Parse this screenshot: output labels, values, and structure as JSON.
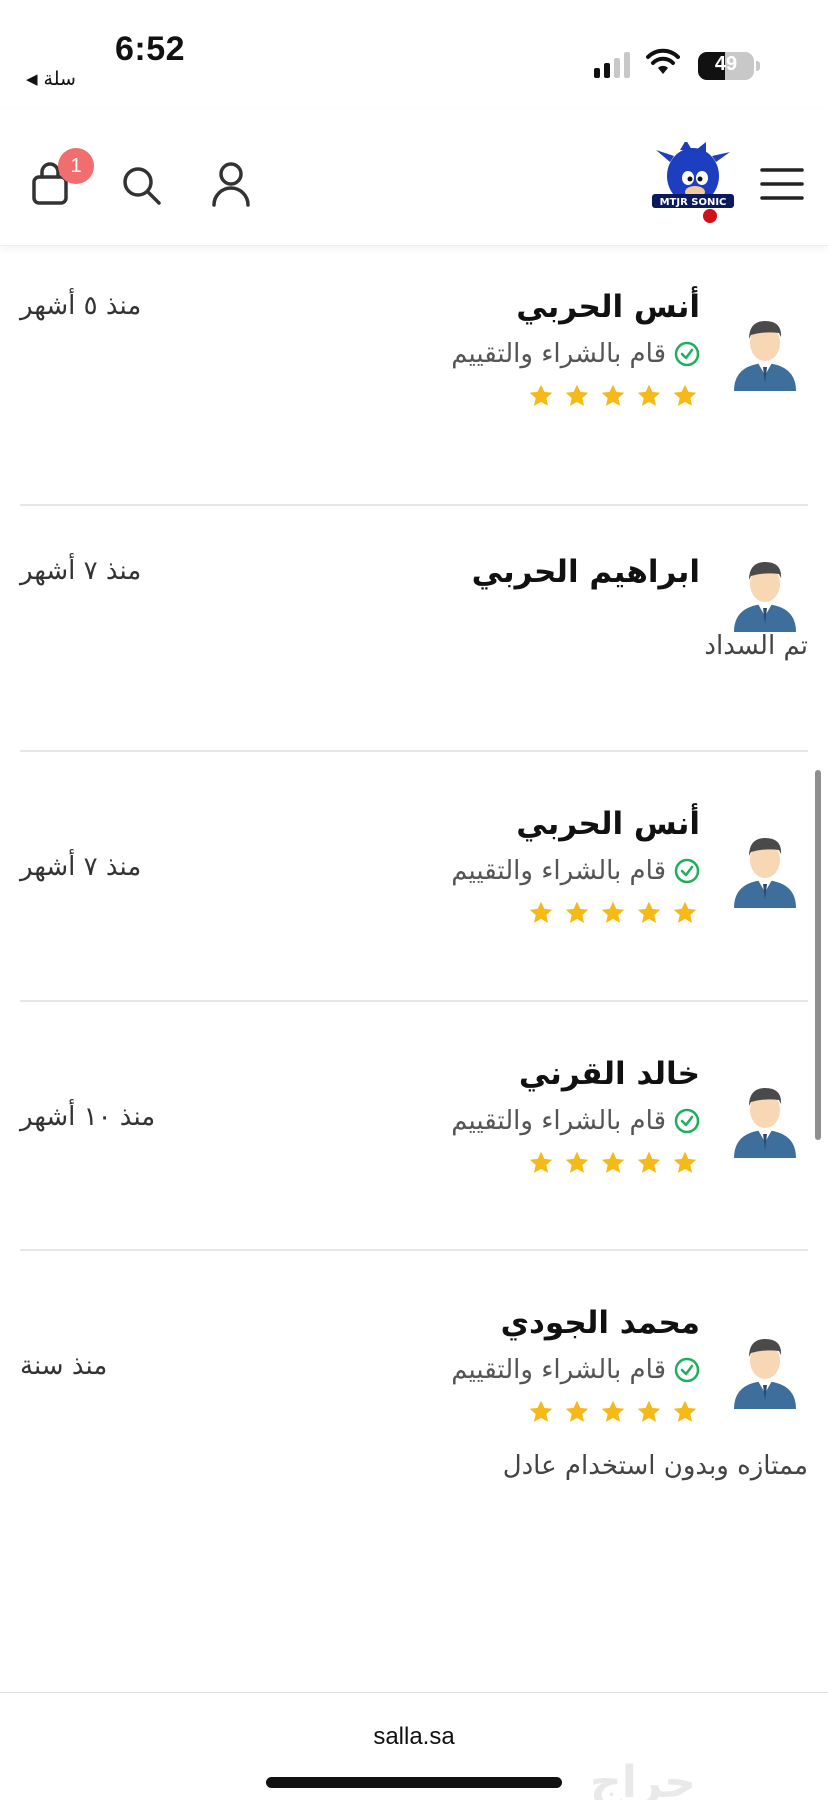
{
  "status_bar": {
    "time": "6:52",
    "back_app": "سلة",
    "back_icon": "back-triangle-icon",
    "battery_percent": "49",
    "battery_level": 0.49,
    "signal_bars": 2
  },
  "header": {
    "cart_badge": "1",
    "logo_text": "MTJR SONIC",
    "icons": [
      "cart-icon",
      "search-icon",
      "user-icon",
      "menu-icon"
    ]
  },
  "colors": {
    "star": "#f5b918",
    "verified": "#1fae5b",
    "badge": "#f26d6d"
  },
  "reviews": [
    {
      "name": "أنس الحربي",
      "verified_label": "قام بالشراء والتقييم",
      "rating": 5,
      "date": "منذ ٥ أشهر",
      "text": ""
    },
    {
      "name": "ابراهيم الحربي",
      "verified_label": "",
      "rating": 0,
      "date": "منذ ٧ أشهر",
      "text": "تم السداد"
    },
    {
      "name": "أنس الحربي",
      "verified_label": "قام بالشراء والتقييم",
      "rating": 5,
      "date": "منذ ٧ أشهر",
      "text": ""
    },
    {
      "name": "خالد القرني",
      "verified_label": "قام بالشراء والتقييم",
      "rating": 5,
      "date": "منذ ١٠ أشهر",
      "text": ""
    },
    {
      "name": "محمد الجودي",
      "verified_label": "قام بالشراء والتقييم",
      "rating": 5,
      "date": "منذ سنة",
      "text": "ممتازه وبدون استخدام عادل"
    }
  ],
  "browser": {
    "url": "salla.sa",
    "watermark": "حراج"
  }
}
